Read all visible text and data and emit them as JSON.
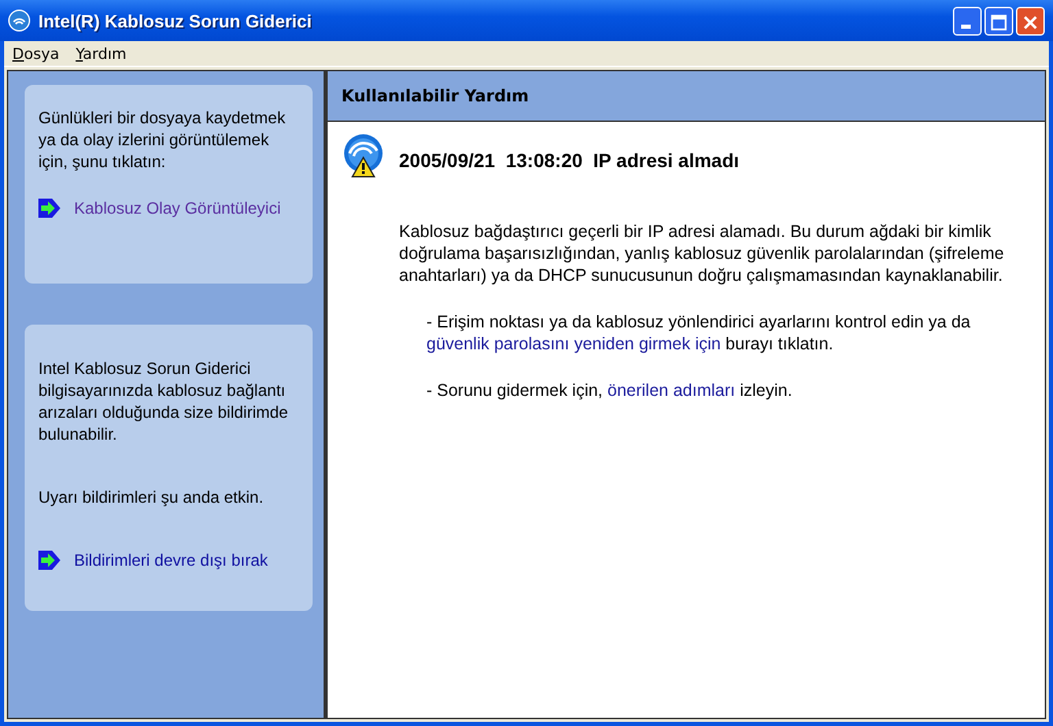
{
  "window": {
    "title": "Intel(R) Kablosuz Sorun Giderici"
  },
  "menu": [
    {
      "label": "Dosya"
    },
    {
      "label": "Yardım"
    }
  ],
  "sidebar": {
    "cards": [
      {
        "texts": [
          "Günlükleri bir dosyaya kaydetmek ya da olay izlerini görüntülemek için, şunu tıklatın:"
        ],
        "link": "Kablosuz Olay Görüntüleyici",
        "link_visited": true
      },
      {
        "texts": [
          "Intel Kablosuz Sorun Giderici bilgisayarınızda kablosuz bağlantı arızaları olduğunda size bildirimde bulunabilir.",
          "Uyarı bildirimleri şu anda etkin."
        ],
        "link": "Bildirimleri devre dışı bırak",
        "link_visited": false
      }
    ]
  },
  "help": {
    "header": "Kullanılabilir Yardım",
    "event": {
      "date": "2005/09/21",
      "time": "13:08:20",
      "message": "IP adresi almadı"
    },
    "description": "Kablosuz bağdaştırıcı geçerli bir IP adresi alamadı. Bu durum ağdaki bir kimlik doğrulama başarısızlığından, yanlış kablosuz güvenlik parolalarından (şifreleme anahtarları) ya da DHCP sunucusunun doğru çalışmamasından kaynaklanabilir.",
    "steps": [
      {
        "before": "- Erişim noktası ya da kablosuz yönlendirici ayarlarını kontrol edin ya da",
        "link": "güvenlik parolasını yeniden girmek için",
        "after": "burayı tıklatın."
      },
      {
        "before": "- Sorunu gidermek için,",
        "link": "önerilen adımları",
        "after": "izleyin."
      }
    ]
  }
}
